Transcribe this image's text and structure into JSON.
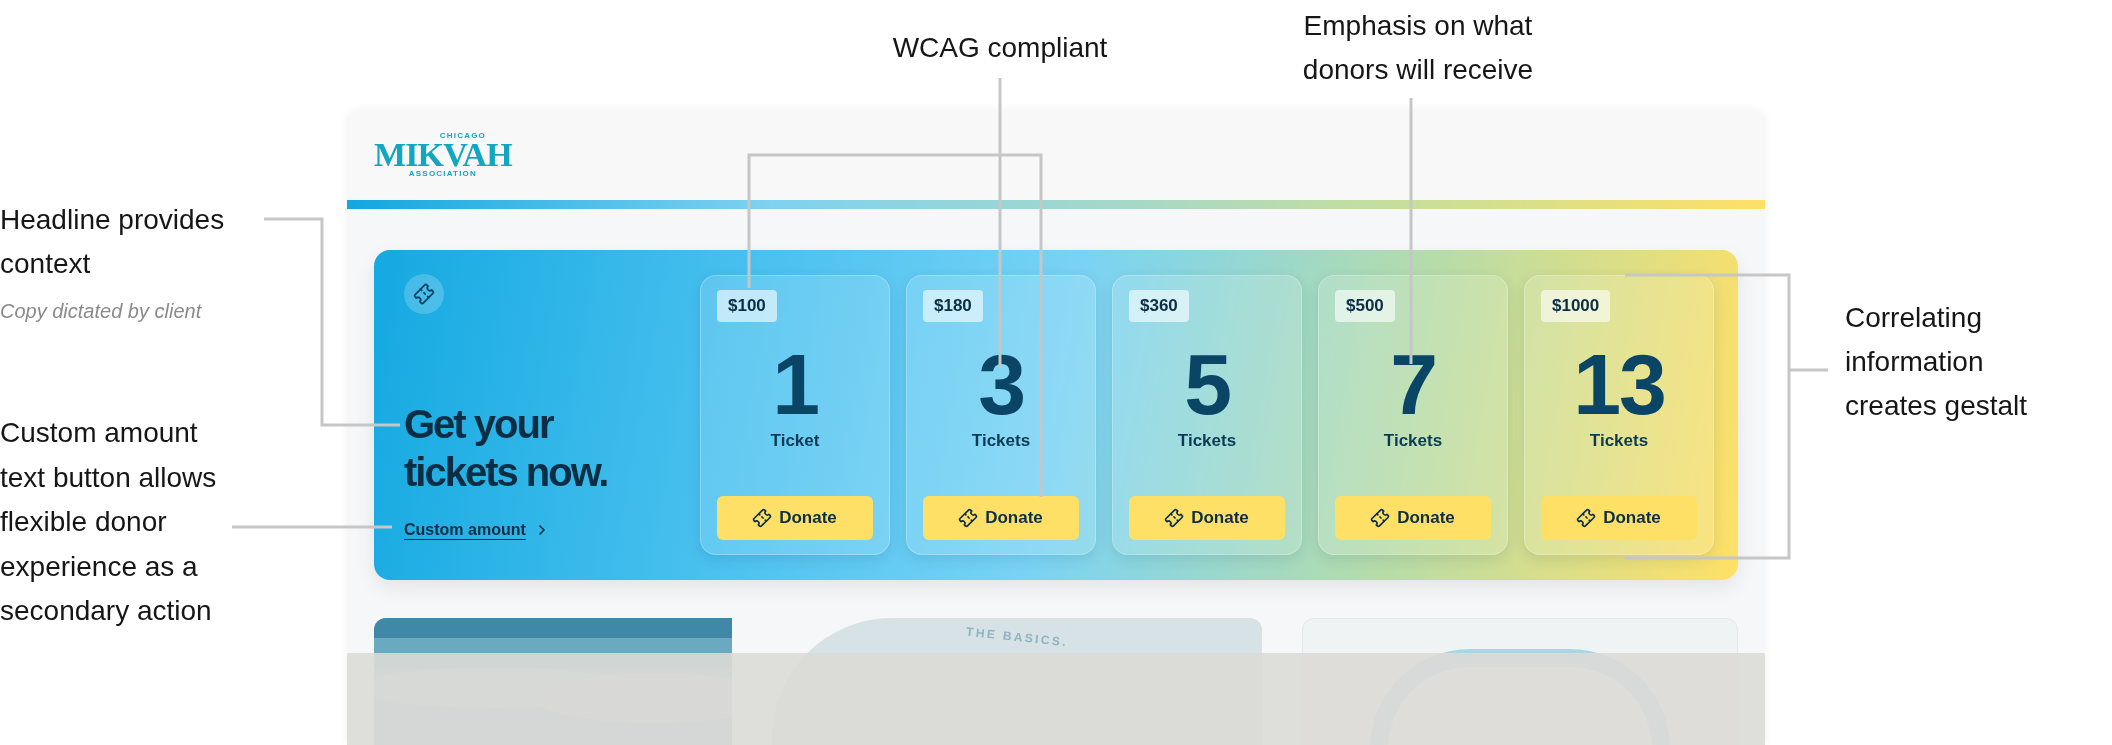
{
  "annotations": {
    "headline": {
      "lines": [
        "Headline provides",
        "context"
      ],
      "note": "Copy dictated by client"
    },
    "custom_amount": {
      "lines": [
        "Custom amount",
        "text button allows",
        "flexible donor",
        "experience as a",
        "secondary action"
      ]
    },
    "wcag": {
      "lines": [
        "WCAG compliant"
      ]
    },
    "emphasis": {
      "lines": [
        "Emphasis on what",
        "donors will receive"
      ]
    },
    "gestalt": {
      "lines": [
        "Correlating",
        "information",
        "creates gestalt"
      ]
    }
  },
  "page": {
    "logo": {
      "top": "CHICAGO",
      "name": "MIKVAH",
      "bottom": "ASSOCIATION"
    },
    "hero": {
      "headline": [
        "Get your",
        "tickets now."
      ],
      "custom_link": "Custom amount",
      "tiers": [
        {
          "price": "$100",
          "count": "1",
          "unit": "Ticket",
          "button": "Donate"
        },
        {
          "price": "$180",
          "count": "3",
          "unit": "Tickets",
          "button": "Donate"
        },
        {
          "price": "$360",
          "count": "5",
          "unit": "Tickets",
          "button": "Donate"
        },
        {
          "price": "$500",
          "count": "7",
          "unit": "Tickets",
          "button": "Donate"
        },
        {
          "price": "$1000",
          "count": "13",
          "unit": "Tickets",
          "button": "Donate"
        }
      ]
    },
    "below": {
      "circle_text": "THE BASICS."
    }
  }
}
